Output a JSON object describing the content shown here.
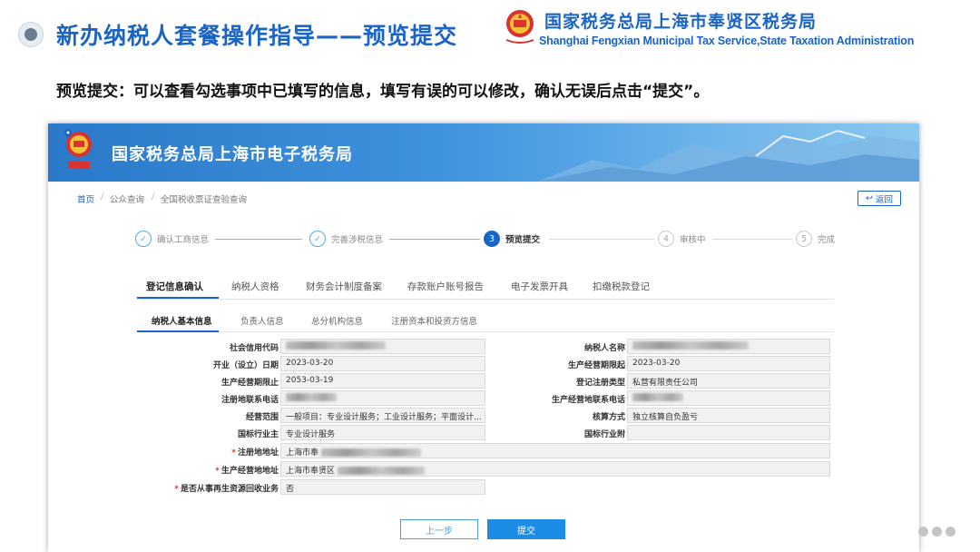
{
  "slide": {
    "title": "新办纳税人套餐操作指导——预览提交",
    "agency_cn": "国家税务总局上海市奉贤区税务局",
    "agency_en": "Shanghai Fengxian Municipal Tax Service,State Taxation Administration",
    "description": "预览提交：可以查看勾选事项中已填写的信息，填写有误的可以修改，确认无误后点击“提交”。",
    "logo_caption": "中国税务"
  },
  "portal": {
    "banner_title": "国家税务总局上海市电子税务局",
    "logo_caption": "中国税务",
    "breadcrumb": [
      "首页",
      "公众查询",
      "全国税收票证查验查询"
    ],
    "back_label": "返回"
  },
  "steps": [
    {
      "num": "✓",
      "label": "确认工商信息",
      "state": "done"
    },
    {
      "num": "✓",
      "label": "完善涉税信息",
      "state": "done"
    },
    {
      "num": "3",
      "label": "预览提交",
      "state": "active"
    },
    {
      "num": "4",
      "label": "审核中",
      "state": "todo"
    },
    {
      "num": "5",
      "label": "完成",
      "state": "todo"
    }
  ],
  "tabs_main": [
    "登记信息确认",
    "纳税人资格",
    "财务会计制度备案",
    "存款账户账号报告",
    "电子发票开具",
    "扣缴税款登记"
  ],
  "tabs_sub": [
    "纳税人基本信息",
    "负责人信息",
    "总分机构信息",
    "注册资本和投资方信息"
  ],
  "form": {
    "credit_code_label": "社会信用代码",
    "taxpayer_name_label": "纳税人名称",
    "open_date_label": "开业（设立）日期",
    "open_date": "2023-03-20",
    "period_start_label": "生产经营期限起",
    "period_start": "2023-03-20",
    "period_end_label": "生产经营期限止",
    "period_end": "2053-03-19",
    "reg_type_label": "登记注册类型",
    "reg_type": "私营有限责任公司",
    "reg_phone_label": "注册地联系电话",
    "biz_phone_label": "生产经营地联系电话",
    "scope_label": "经营范围",
    "scope": "一般项目：专业设计服务；工业设计服务；平面设计...",
    "accounting_label": "核算方式",
    "accounting": "独立核算自负盈亏",
    "industry_main_label": "国标行业主",
    "industry_main": "专业设计服务",
    "industry_sub_label": "国标行业附",
    "reg_address_label": "注册地地址",
    "reg_address": "上海市奉",
    "biz_address_label": "生产经营地地址",
    "biz_address": "上海市奉贤区",
    "recycle_label": "是否从事再生资源回收业务",
    "recycle": "否",
    "required_mark": "*"
  },
  "buttons": {
    "prev": "上一步",
    "submit": "提交"
  },
  "colors": {
    "primary": "#1a64c6",
    "submit": "#1c8ce6",
    "required": "#e23b3b"
  }
}
